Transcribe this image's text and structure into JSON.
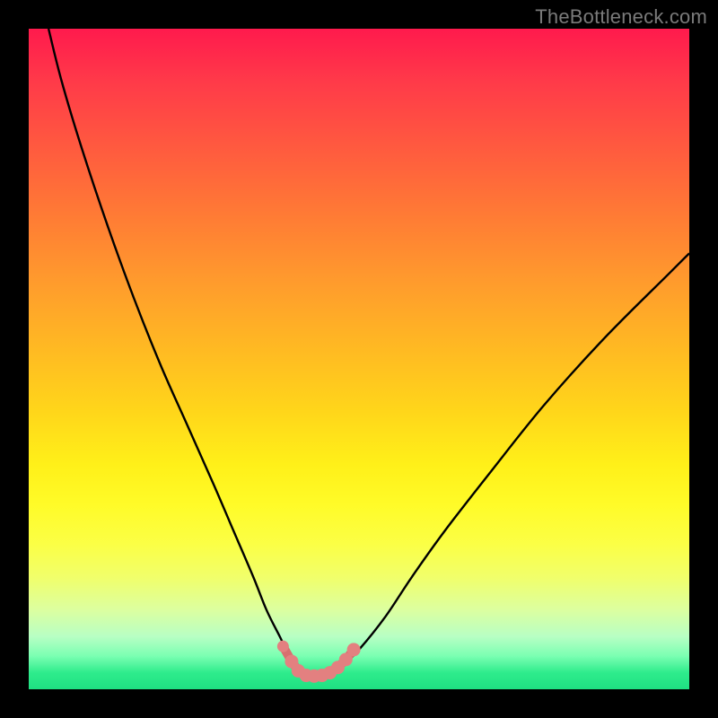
{
  "watermark": "TheBottleneck.com",
  "palette": {
    "frame": "#000000",
    "curve": "#000000",
    "marker": "#e38080",
    "marker_stroke": "#d86f6f"
  },
  "chart_data": {
    "type": "line",
    "title": "",
    "xlabel": "",
    "ylabel": "",
    "xlim": [
      0,
      100
    ],
    "ylim": [
      0,
      100
    ],
    "series": [
      {
        "name": "bottleneck-curve",
        "x": [
          3,
          5,
          8,
          12,
          16,
          20,
          24,
          28,
          31,
          34,
          36,
          38,
          39.5,
          41,
          42.5,
          44,
          45.5,
          47,
          50,
          54,
          58,
          63,
          70,
          78,
          87,
          97,
          100
        ],
        "y": [
          100,
          92,
          82,
          70,
          59,
          49,
          40,
          31,
          24,
          17,
          12,
          8,
          5,
          3,
          2,
          2,
          2,
          3,
          6,
          11,
          17,
          24,
          33,
          43,
          53,
          63,
          66
        ]
      }
    ],
    "markers": {
      "name": "valley-markers",
      "points": [
        {
          "x": 38.5,
          "y": 6.5
        },
        {
          "x": 39.8,
          "y": 4.2
        },
        {
          "x": 40.8,
          "y": 2.8
        },
        {
          "x": 42.0,
          "y": 2.1
        },
        {
          "x": 43.2,
          "y": 2.0
        },
        {
          "x": 44.4,
          "y": 2.1
        },
        {
          "x": 45.6,
          "y": 2.5
        },
        {
          "x": 46.8,
          "y": 3.3
        },
        {
          "x": 48.0,
          "y": 4.5
        },
        {
          "x": 49.2,
          "y": 6.0
        }
      ]
    }
  }
}
